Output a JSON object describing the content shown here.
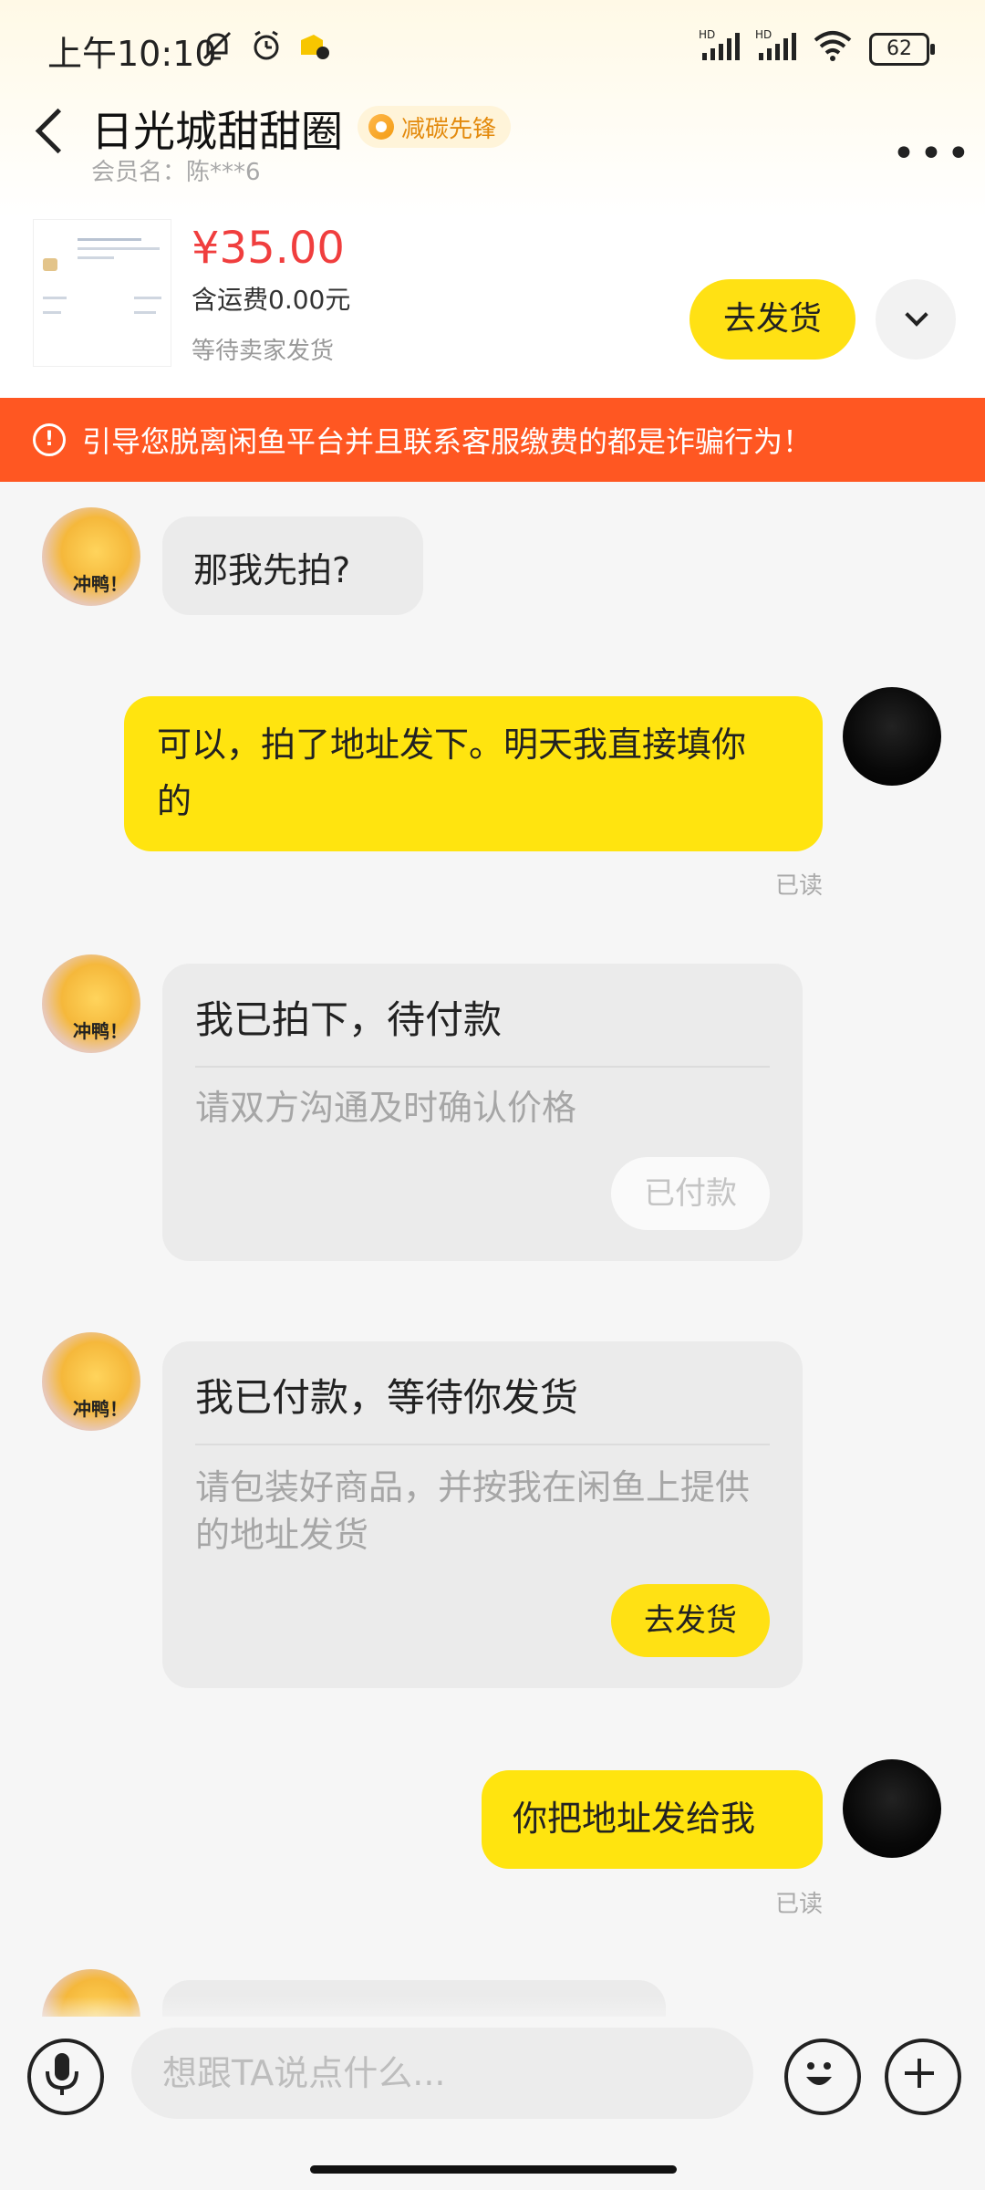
{
  "status_bar": {
    "time": "上午10:10",
    "battery": "62"
  },
  "header": {
    "title": "日光城甜甜圈",
    "badge": "减碳先锋",
    "member": "会员名：陈***6"
  },
  "order": {
    "price": "¥35.00",
    "shipping": "含运费0.00元",
    "status": "等待卖家发货",
    "ship_button": "去发货"
  },
  "warning": "引导您脱离闲鱼平台并且联系客服缴费的都是诈骗行为！",
  "avatar_text": "冲鸭！",
  "messages": [
    {
      "from": "other",
      "text": "那我先拍?"
    },
    {
      "from": "me",
      "text": "可以，拍了地址发下。明天我直接填你的",
      "status": "已读"
    },
    {
      "from": "other",
      "type": "card",
      "title": "我已拍下，待付款",
      "desc": "请双方沟通及时确认价格",
      "button": "已付款"
    },
    {
      "from": "other",
      "type": "card",
      "title": "我已付款，等待你发货",
      "desc": "请包装好商品，并按我在闲鱼上提供的地址发货",
      "button": "去发货"
    },
    {
      "from": "me",
      "text": "你把地址发给我",
      "status": "已读"
    }
  ],
  "input": {
    "placeholder": "想跟TA说点什么..."
  },
  "colors": {
    "accent": "#ffe114",
    "warning_bg": "#ff5722",
    "price": "#f03e3e"
  }
}
